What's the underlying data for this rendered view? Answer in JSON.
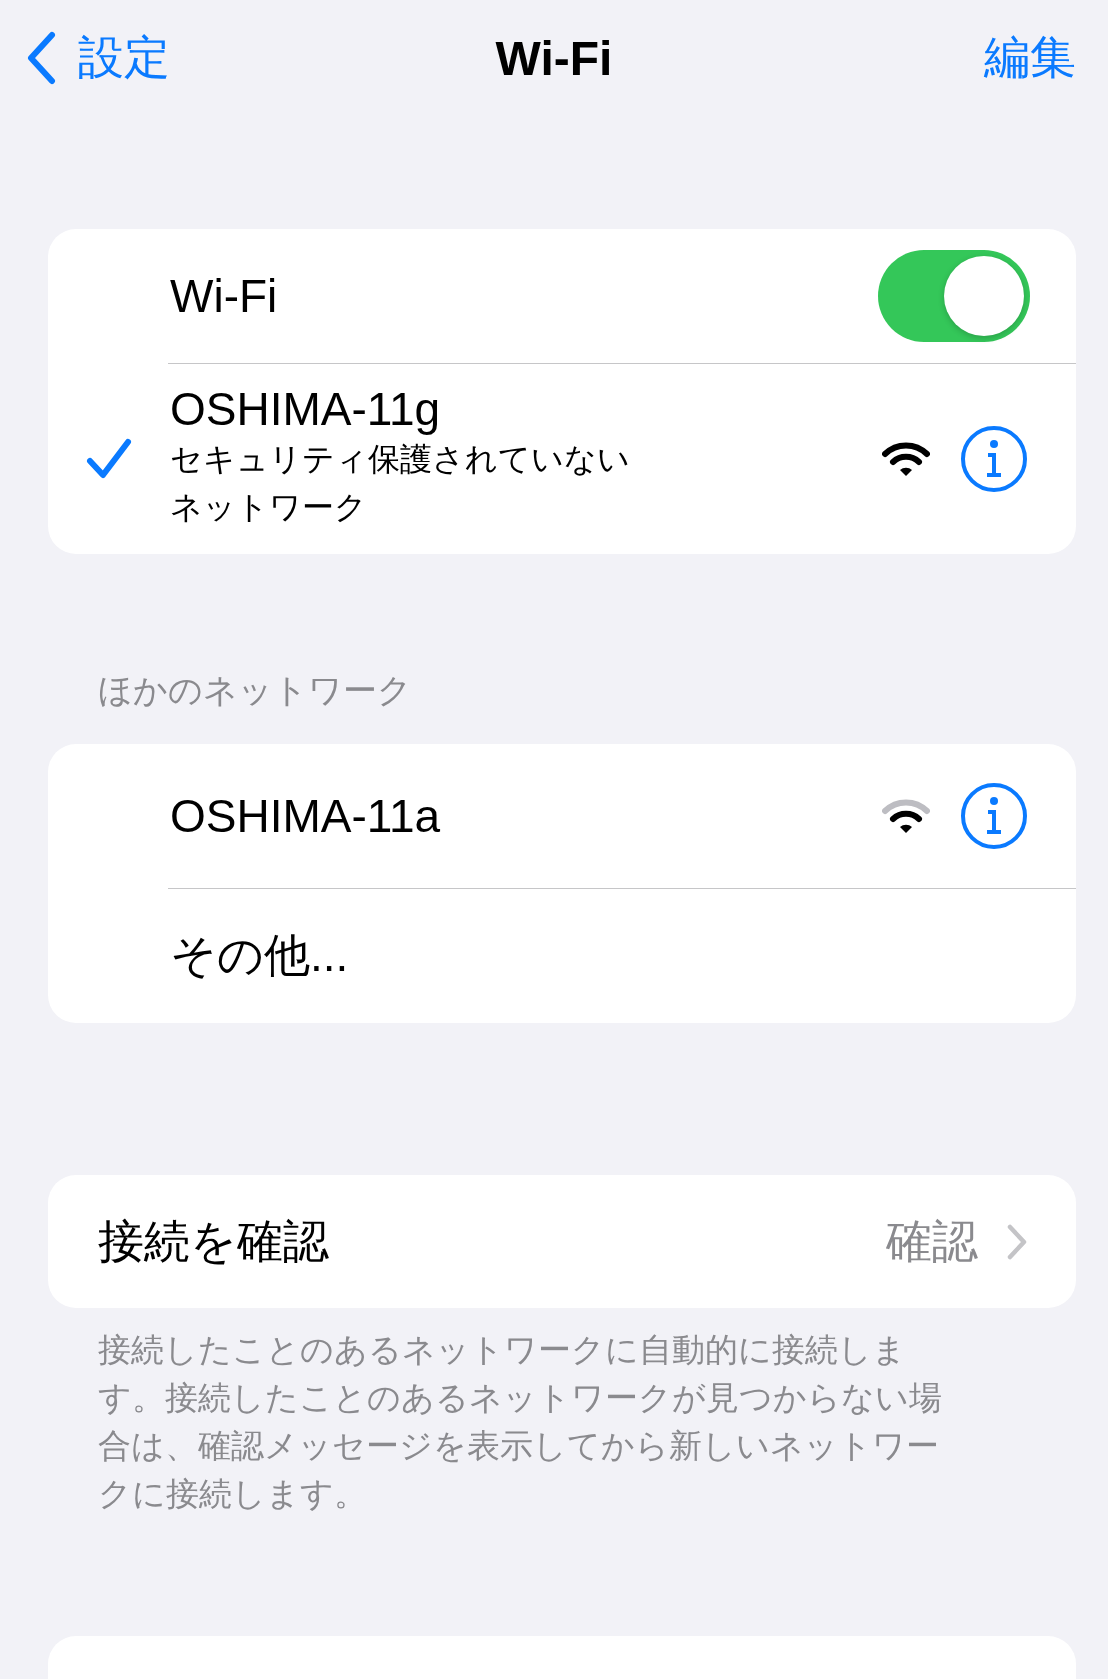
{
  "nav": {
    "back": "設定",
    "title": "Wi-Fi",
    "edit": "編集"
  },
  "wifi_toggle": {
    "label": "Wi-Fi",
    "on": true
  },
  "current_network": {
    "name": "OSHIMA-11g",
    "subtitle": "セキュリティ保護されていないネットワーク",
    "connected": true,
    "weak_signal": false
  },
  "other_header": "ほかのネットワーク",
  "other_networks": [
    {
      "kind": "network",
      "name": "OSHIMA-11a",
      "weak_signal": true
    },
    {
      "kind": "other",
      "name": "その他..."
    }
  ],
  "ask_to_join": {
    "label": "接続を確認",
    "value": "確認"
  },
  "footer": "接続したことのあるネットワークに自動的に接続します。接続したことのあるネットワークが見つからない場合は、確認メッセージを表示してから新しいネットワークに接続します。"
}
